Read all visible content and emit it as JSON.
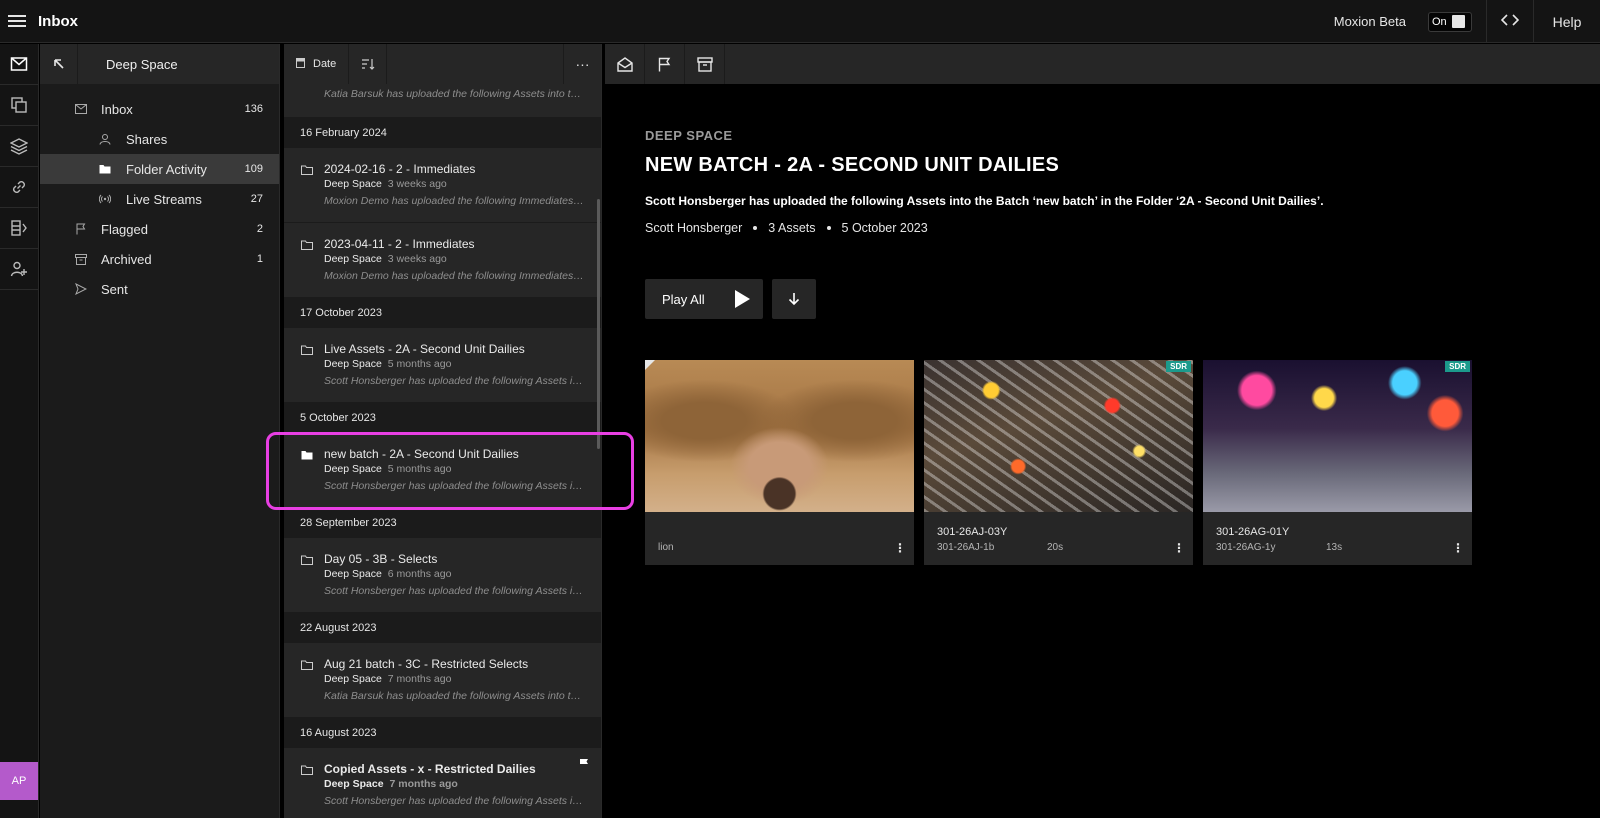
{
  "app": {
    "title": "Inbox",
    "beta_label": "Moxion Beta",
    "toggle_label": "On",
    "help_label": "Help"
  },
  "avatar": {
    "initials": "AP"
  },
  "tree": {
    "title": "Deep Space",
    "items": [
      {
        "label": "Inbox",
        "count": "136"
      },
      {
        "label": "Shares",
        "count": ""
      },
      {
        "label": "Folder Activity",
        "count": "109"
      },
      {
        "label": "Live Streams",
        "count": "27"
      },
      {
        "label": "Flagged",
        "count": "2"
      },
      {
        "label": "Archived",
        "count": "1"
      },
      {
        "label": "Sent",
        "count": ""
      }
    ]
  },
  "list": {
    "sort_label": "Date",
    "top_desc": "Katia Barsuk has uploaded the following Assets into the Batch",
    "groups": [
      {
        "date": "16 February 2024",
        "cards": [
          {
            "title": "2024-02-16 - 2 - Immediates",
            "folder": "Deep Space",
            "ago": "3 weeks ago",
            "desc": "Moxion Demo has uploaded the following Immediates into the Batch"
          },
          {
            "title": "2023-04-11 - 2 - Immediates",
            "folder": "Deep Space",
            "ago": "3 weeks ago",
            "desc": "Moxion Demo has uploaded the following Immediates into the Batch"
          }
        ]
      },
      {
        "date": "17 October 2023",
        "cards": [
          {
            "title": "Live Assets - 2A - Second Unit Dailies",
            "folder": "Deep Space",
            "ago": "5 months ago",
            "desc": "Scott Honsberger has uploaded the following Assets into the Batch"
          }
        ]
      },
      {
        "date": "5 October 2023",
        "cards": [
          {
            "title": "new batch - 2A - Second Unit Dailies",
            "folder": "Deep Space",
            "ago": "5 months ago",
            "desc": "Scott Honsberger has uploaded the following Assets into the Batch"
          }
        ]
      },
      {
        "date": "28 September 2023",
        "cards": [
          {
            "title": "Day 05 - 3B - Selects",
            "folder": "Deep Space",
            "ago": "6 months ago",
            "desc": "Scott Honsberger has uploaded the following Assets into the Batch"
          }
        ]
      },
      {
        "date": "22 August 2023",
        "cards": [
          {
            "title": "Aug 21 batch - 3C - Restricted Selects",
            "folder": "Deep Space",
            "ago": "7 months ago",
            "desc": "Katia Barsuk has uploaded the following Assets into the Batch"
          }
        ]
      },
      {
        "date": "16 August 2023",
        "cards": [
          {
            "title": "Copied Assets - x - Restricted Dailies",
            "folder": "Deep Space",
            "ago": "7 months ago",
            "desc": "Scott Honsberger has uploaded the following Assets into the Batch"
          }
        ]
      }
    ]
  },
  "detail": {
    "folder": "DEEP SPACE",
    "title": "NEW BATCH - 2A - SECOND UNIT DAILIES",
    "desc": "Scott Honsberger has uploaded the following Assets into the Batch ‘new batch’ in the Folder ‘2A - Second Unit Dailies’.",
    "author": "Scott Honsberger",
    "asset_count": "3 Assets",
    "date": "5 October 2023",
    "play_label": "Play All",
    "assets": [
      {
        "name": "",
        "sub": "lion",
        "duration": "",
        "badge": ""
      },
      {
        "name": "301-26AJ-03Y",
        "sub": "301-26AJ-1b",
        "duration": "20s",
        "badge": "SDR"
      },
      {
        "name": "301-26AG-01Y",
        "sub": "301-26AG-1y",
        "duration": "13s",
        "badge": "SDR"
      }
    ]
  },
  "colors": {
    "accent_highlight": "#e83fe3",
    "avatar": "#b45acb",
    "sdr_badge": "#1c9a8c"
  }
}
